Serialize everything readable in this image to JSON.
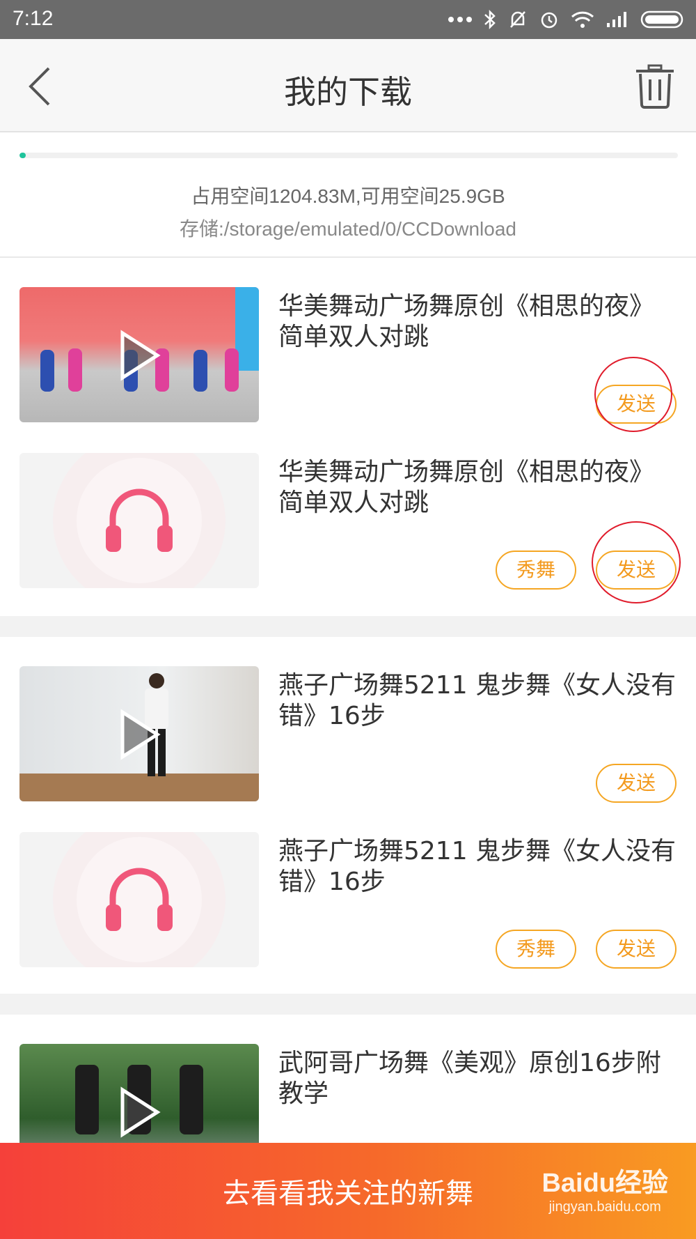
{
  "status_bar": {
    "time": "7:12"
  },
  "header": {
    "title": "我的下载"
  },
  "storage": {
    "usage_fraction": 0.01,
    "summary": "占用空间1204.83M,可用空间25.9GB",
    "path": "存储:/storage/emulated/0/CCDownload"
  },
  "items": [
    {
      "title": "华美舞动广场舞原创《相思的夜》简单双人对跳",
      "thumb": "video-thumbnail",
      "send_label": "发送"
    },
    {
      "title": "华美舞动广场舞原创《相思的夜》简单双人对跳",
      "thumb": "audio-thumbnail",
      "show_label": "秀舞",
      "send_label": "发送"
    },
    {
      "title": "燕子广场舞5211 鬼步舞《女人没有错》16步",
      "thumb": "video-thumbnail",
      "send_label": "发送"
    },
    {
      "title": "燕子广场舞5211 鬼步舞《女人没有错》16步",
      "thumb": "audio-thumbnail",
      "show_label": "秀舞",
      "send_label": "发送"
    },
    {
      "title": "武阿哥广场舞《美观》原创16步附教学",
      "thumb": "video-thumbnail"
    }
  ],
  "bottom_bar": {
    "label": "去看看我关注的新舞"
  },
  "watermark": {
    "brand": "Baidu经验",
    "url": "jingyan.baidu.com"
  },
  "colors": {
    "accent": "#f39a1e",
    "progress": "#1fc39b",
    "annotation": "#e01b2b"
  }
}
